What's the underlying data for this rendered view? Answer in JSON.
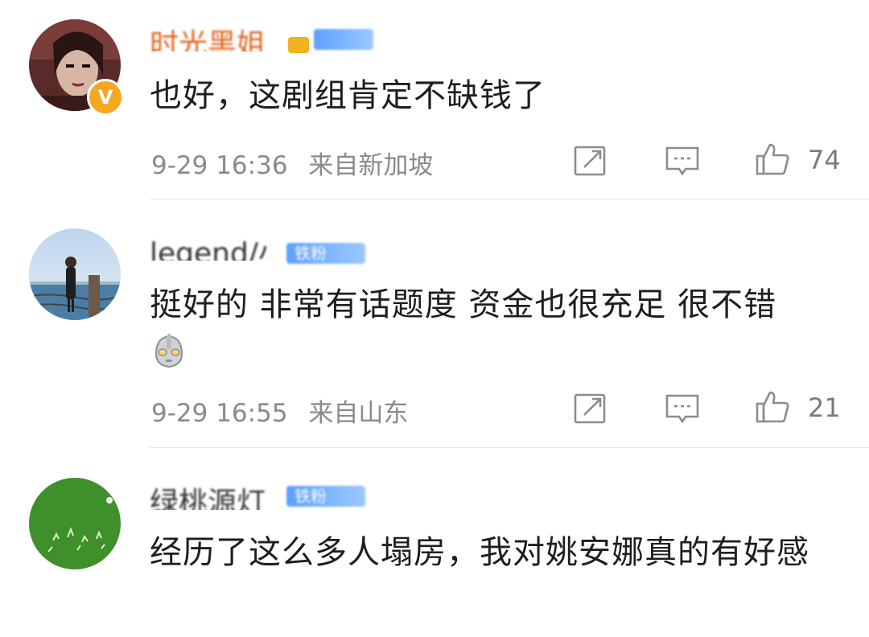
{
  "comments": [
    {
      "username": "时光黑姐",
      "verified": true,
      "member_badge": "",
      "text": "也好，这剧组肯定不缺钱了",
      "time": "9-29 16:36",
      "location": "来自新加坡",
      "likes": "74"
    },
    {
      "username": "legend/小",
      "verified": false,
      "member_badge": "铁粉",
      "text": "挺好的 非常有话题度 资金也很充足 很不错",
      "emoji": "ultraman-emoji",
      "time": "9-29 16:55",
      "location": "来自山东",
      "likes": "21"
    },
    {
      "username": "绿桃源灯",
      "verified": false,
      "member_badge": "铁粉",
      "text": "经历了这么多人塌房，我对姚安娜真的有好感",
      "time": "",
      "location": "",
      "likes": ""
    }
  ],
  "colors": {
    "text_primary": "#1e1e1e",
    "text_meta": "#8a8a8a",
    "verified_badge": "#f5a623",
    "member_badge": "#5ea0ff",
    "divider": "#e6e6e6"
  },
  "icons": [
    "repost-icon",
    "comment-icon",
    "like-icon"
  ]
}
